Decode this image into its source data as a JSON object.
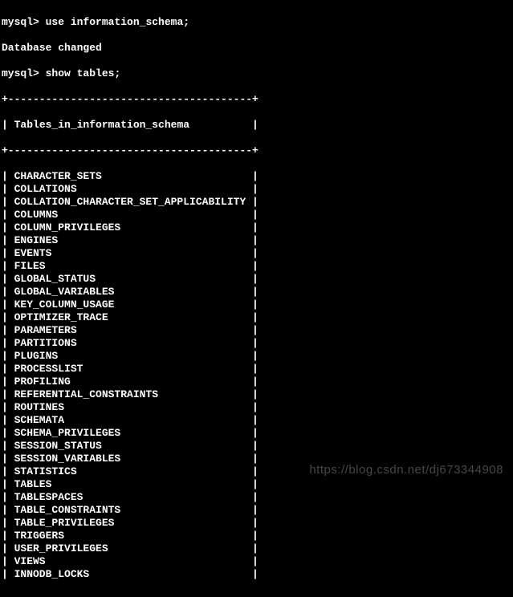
{
  "prompt": "mysql>",
  "commands": {
    "use_command": "use information_schema;",
    "use_response": "Database changed",
    "show_command": "show tables;"
  },
  "table": {
    "header": "Tables_in_information_schema",
    "border_line": "+---------------------------------------+",
    "rows": [
      "CHARACTER_SETS",
      "COLLATIONS",
      "COLLATION_CHARACTER_SET_APPLICABILITY",
      "COLUMNS",
      "COLUMN_PRIVILEGES",
      "ENGINES",
      "EVENTS",
      "FILES",
      "GLOBAL_STATUS",
      "GLOBAL_VARIABLES",
      "KEY_COLUMN_USAGE",
      "OPTIMIZER_TRACE",
      "PARAMETERS",
      "PARTITIONS",
      "PLUGINS",
      "PROCESSLIST",
      "PROFILING",
      "REFERENTIAL_CONSTRAINTS",
      "ROUTINES",
      "SCHEMATA",
      "SCHEMA_PRIVILEGES",
      "SESSION_STATUS",
      "SESSION_VARIABLES",
      "STATISTICS",
      "TABLES",
      "TABLESPACES",
      "TABLE_CONSTRAINTS",
      "TABLE_PRIVILEGES",
      "TRIGGERS",
      "USER_PRIVILEGES",
      "VIEWS",
      "INNODB_LOCKS"
    ]
  },
  "watermark": "https://blog.csdn.net/dj673344908"
}
